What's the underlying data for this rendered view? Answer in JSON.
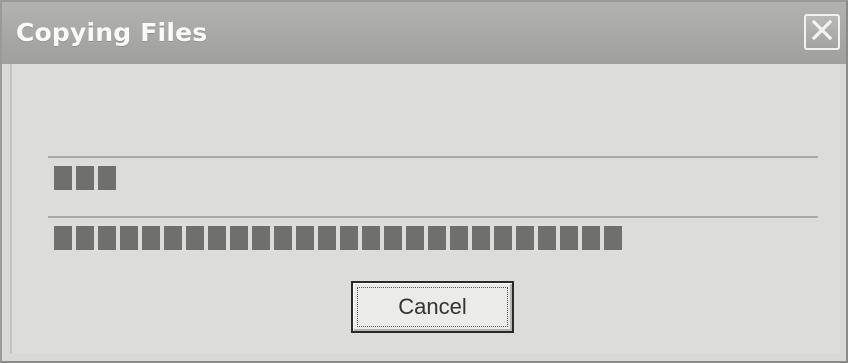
{
  "window": {
    "title": "Copying Files",
    "close_icon": "close-icon"
  },
  "progress": {
    "current_file": {
      "filled_segments": 3,
      "fraction": 0.08
    },
    "total": {
      "filled_segments": 26,
      "fraction": 0.72
    }
  },
  "buttons": {
    "cancel_label": "Cancel"
  },
  "colors": {
    "title_text": "#fafafa",
    "progress_fill": "#6f6f6d",
    "dialog_bg": "#dcdcda"
  }
}
